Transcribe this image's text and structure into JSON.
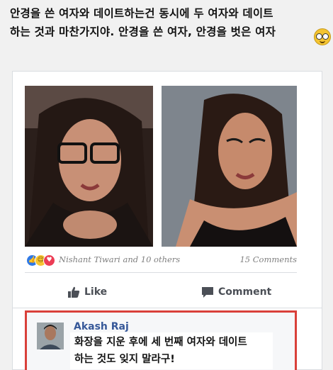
{
  "caption": {
    "line1": "안경을 쓴 여자와 데이트하는건 동시에 두 여자와 데이트",
    "line2": "하는 것과 마찬가지야. 안경을 쓴 여자, 안경을 벗은 여자"
  },
  "caption_emoji": "nerd-face-emoji",
  "post": {
    "reactions": {
      "icons": [
        "like",
        "haha",
        "love"
      ],
      "reactors": "Nishant Tiwari and 10 others",
      "comments_count": "15 Comments"
    },
    "actions": {
      "like_label": "Like",
      "comment_label": "Comment"
    },
    "comment": {
      "author": "Akash Raj",
      "text_line1": "화장을 지운 후에 세 번째 여자와 데이트",
      "text_line2": "하는 것도 잊지 말라구!"
    }
  },
  "colors": {
    "facebook_blue": "#365899",
    "highlight_red": "#d9403a",
    "like_blue": "#2f79e6",
    "love_red": "#ec3d55",
    "haha_yellow": "#f7c531"
  }
}
